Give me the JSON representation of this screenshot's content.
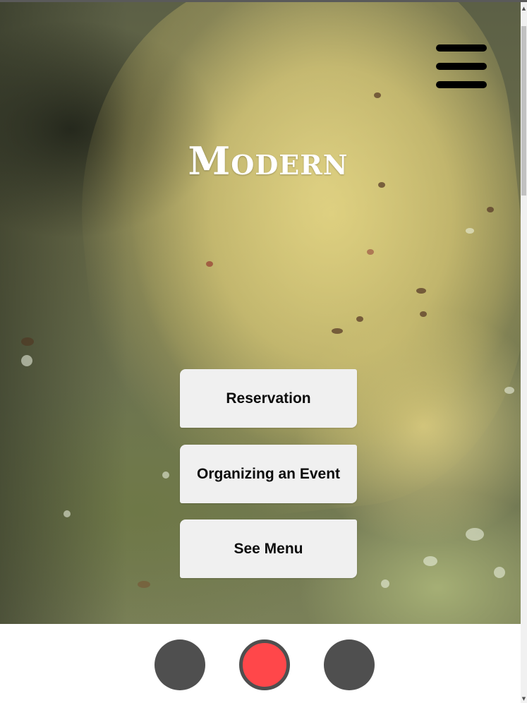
{
  "brand": {
    "title": "Modern"
  },
  "actions": [
    {
      "label": "Reservation"
    },
    {
      "label": "Organizing an Event"
    },
    {
      "label": "See Menu"
    }
  ],
  "menu": {
    "icon": "hamburger-menu-icon"
  },
  "pagination": {
    "count": 3,
    "active_index": 1,
    "active_color": "#ff474a",
    "inactive_color": "#4f4f4f"
  },
  "scrollbar": {
    "up_arrow": "▲",
    "down_arrow": "▼"
  }
}
